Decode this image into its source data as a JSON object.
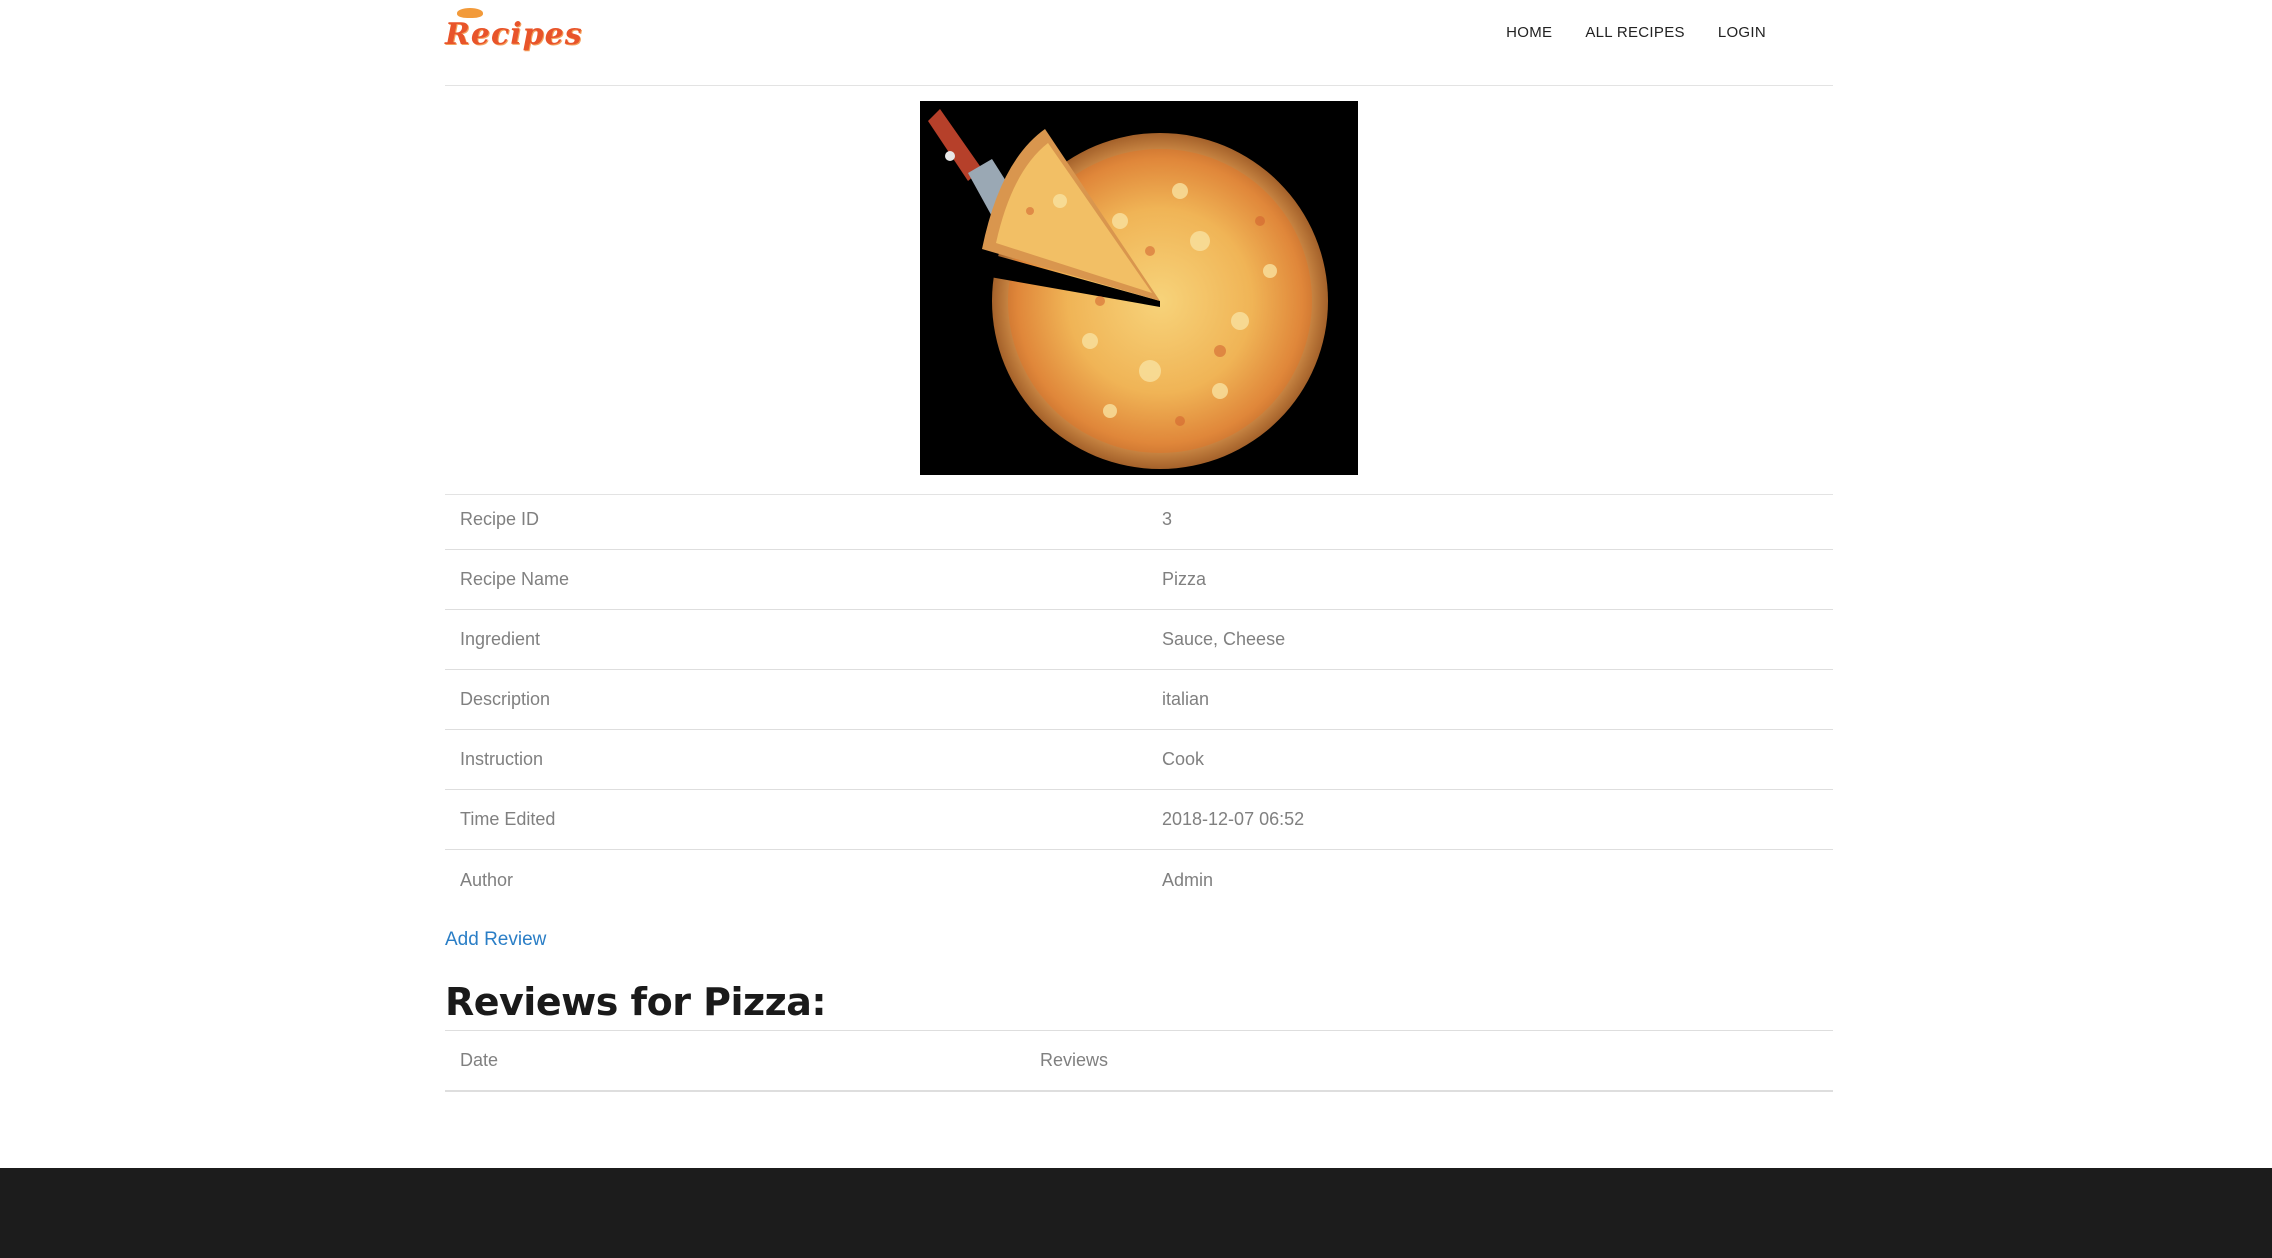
{
  "header": {
    "logo_text": "Recipes",
    "nav": [
      {
        "label": "HOME"
      },
      {
        "label": "ALL RECIPES"
      },
      {
        "label": "LOGIN"
      }
    ]
  },
  "recipe": {
    "image_alt": "pizza-photo",
    "rows": [
      {
        "label": "Recipe ID",
        "value": "3"
      },
      {
        "label": "Recipe Name",
        "value": "Pizza"
      },
      {
        "label": "Ingredient",
        "value": "Sauce, Cheese"
      },
      {
        "label": "Description",
        "value": "italian"
      },
      {
        "label": "Instruction",
        "value": "Cook"
      },
      {
        "label": "Time Edited",
        "value": "2018-12-07 06:52"
      },
      {
        "label": "Author",
        "value": "Admin"
      }
    ]
  },
  "reviews": {
    "add_link": "Add Review",
    "title": "Reviews for Pizza:",
    "columns": {
      "date": "Date",
      "reviews": "Reviews"
    }
  },
  "colors": {
    "brand": "#e8542a",
    "link": "#2a7ec6",
    "footer": "#1c1c1c"
  }
}
